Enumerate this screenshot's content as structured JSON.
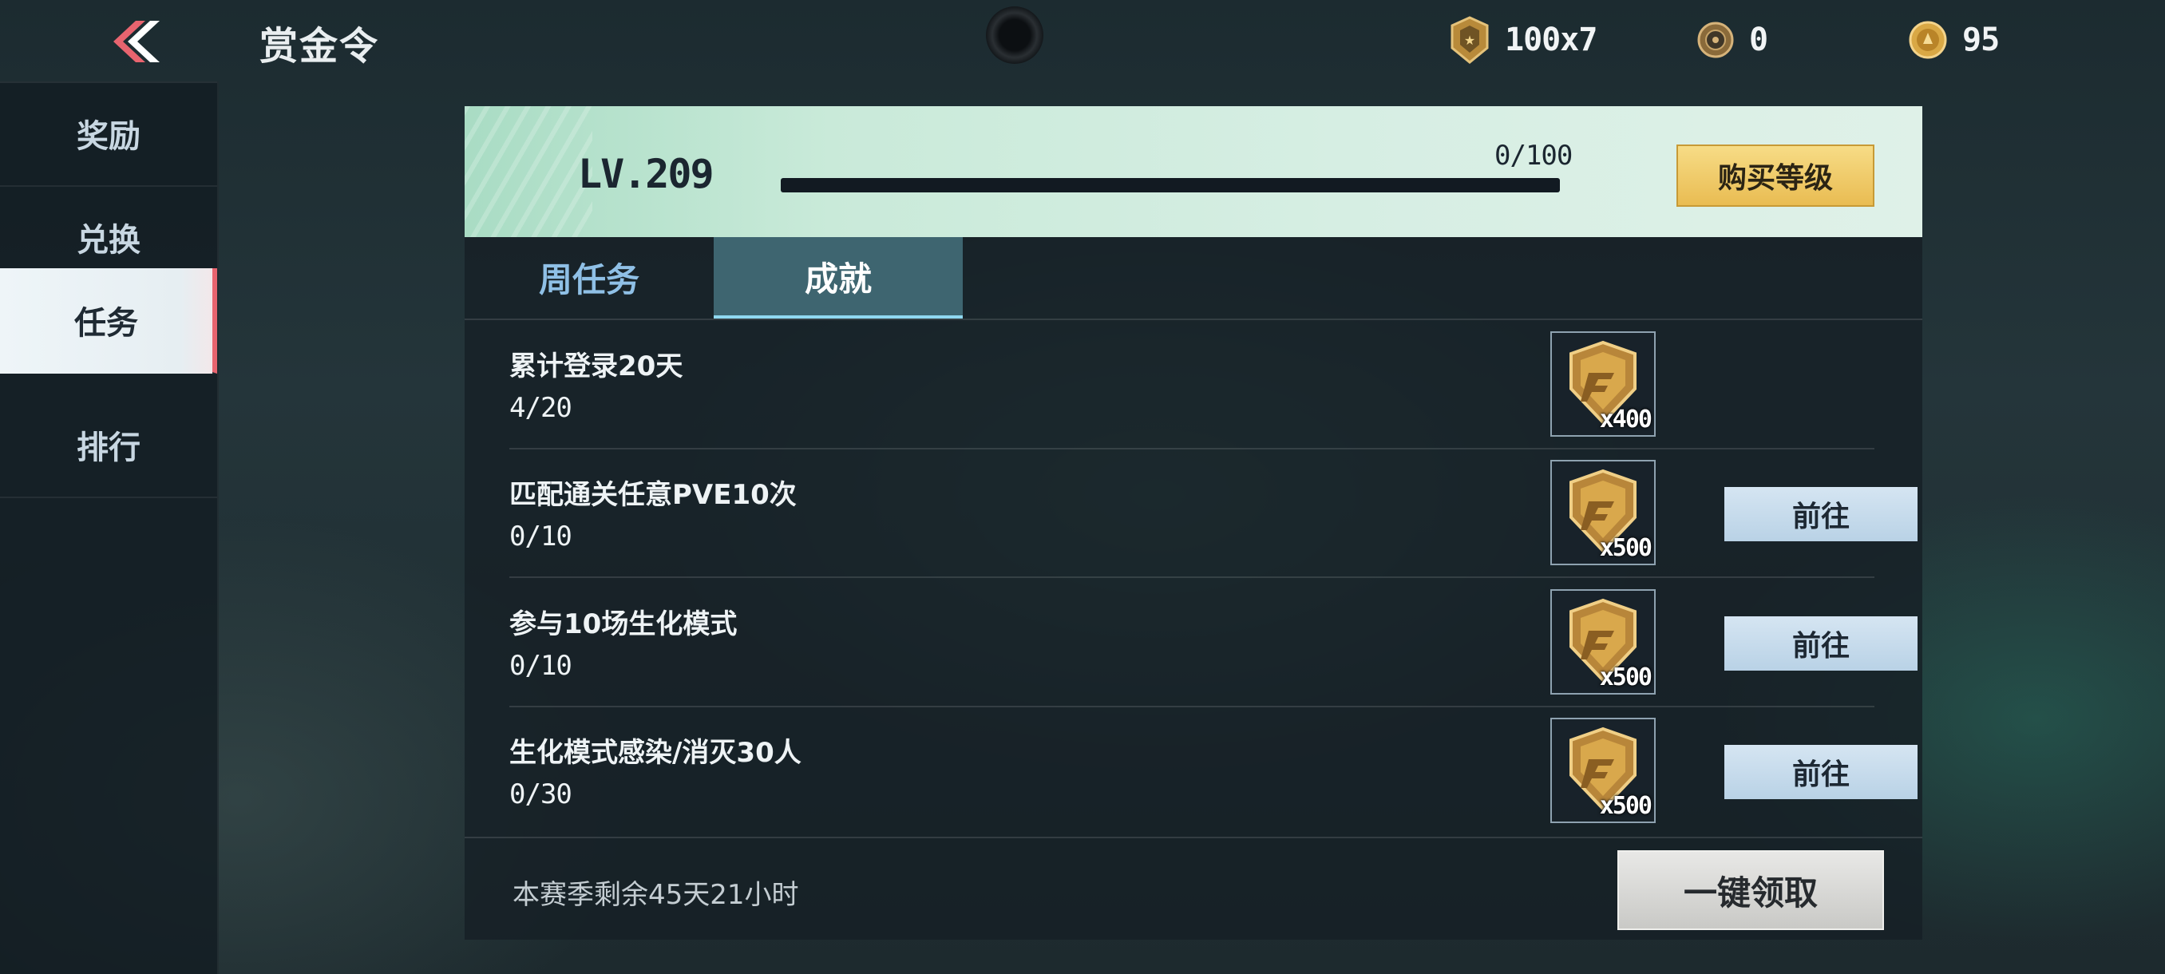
{
  "header": {
    "title": "赏金令",
    "currencies": [
      {
        "icon": "medal-coin-icon",
        "value": "100x7"
      },
      {
        "icon": "bronze-coin-icon",
        "value": "0"
      },
      {
        "icon": "gold-coin-icon",
        "value": "95"
      }
    ]
  },
  "sidebar": {
    "items": [
      {
        "label": "奖励",
        "active": false
      },
      {
        "label": "兑换",
        "active": false
      },
      {
        "label": "任务",
        "active": true
      },
      {
        "label": "排行",
        "active": false
      }
    ]
  },
  "level": {
    "label": "LV.209",
    "xp_text": "0/100",
    "xp_fraction": 0.0,
    "buy_label": "购买等级"
  },
  "tabs": [
    {
      "label": "周任务",
      "active": false
    },
    {
      "label": "成就",
      "active": true
    }
  ],
  "tasks": [
    {
      "title": "累计登录20天",
      "progress": "4/20",
      "reward_qty": "x400",
      "reward_icon": "cf-shield-token-icon",
      "button": null
    },
    {
      "title": "匹配通关任意PVE10次",
      "progress": "0/10",
      "reward_qty": "x500",
      "reward_icon": "cf-shield-token-icon",
      "button": "前往"
    },
    {
      "title": "参与10场生化模式",
      "progress": "0/10",
      "reward_qty": "x500",
      "reward_icon": "cf-shield-token-icon",
      "button": "前往"
    },
    {
      "title": "生化模式感染/消灭30人",
      "progress": "0/30",
      "reward_qty": "x500",
      "reward_icon": "cf-shield-token-icon",
      "button": "前往"
    }
  ],
  "footer": {
    "season_text": "本赛季剩余45天21小时",
    "claim_all_label": "一键领取"
  },
  "colors": {
    "accent_red": "#e8646f",
    "level_strip": "#d6eee3",
    "gold_button": "#e9bc52",
    "go_button": "#b9d2e6",
    "active_tab": "#3e6570"
  }
}
